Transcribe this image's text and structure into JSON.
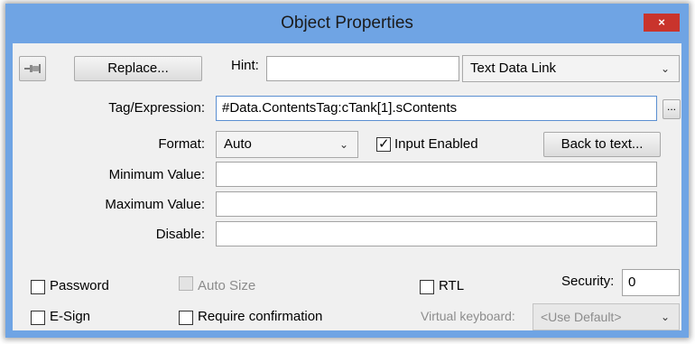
{
  "window": {
    "title": "Object Properties",
    "close_glyph": "×"
  },
  "toolbar": {
    "pin_icon": "pushpin-icon",
    "replace_label": "Replace...",
    "hint_label": "Hint:",
    "hint_value": "",
    "link_type_selected": "Text Data Link"
  },
  "tag": {
    "label": "Tag/Expression:",
    "value": "#Data.ContentsTag:cTank[1].sContents",
    "browse_label": "..."
  },
  "format": {
    "label": "Format:",
    "selected": "Auto",
    "input_enabled_label": "Input Enabled",
    "input_enabled": true,
    "back_label": "Back to text..."
  },
  "minimum": {
    "label": "Minimum Value:",
    "value": ""
  },
  "maximum": {
    "label": "Maximum Value:",
    "value": ""
  },
  "disable": {
    "label": "Disable:",
    "value": ""
  },
  "options": {
    "password_label": "Password",
    "password_checked": false,
    "autosize_label": "Auto Size",
    "rtl_label": "RTL",
    "security_label": "Security:",
    "security_value": "0",
    "esign_label": "E-Sign",
    "require_confirmation_label": "Require confirmation",
    "virtual_keyboard_label": "Virtual keyboard:",
    "virtual_keyboard_selected": "<Use Default>"
  },
  "colors": {
    "titlebar": "#6fa4e4",
    "close": "#c9342c",
    "client": "#f0f0f0"
  }
}
